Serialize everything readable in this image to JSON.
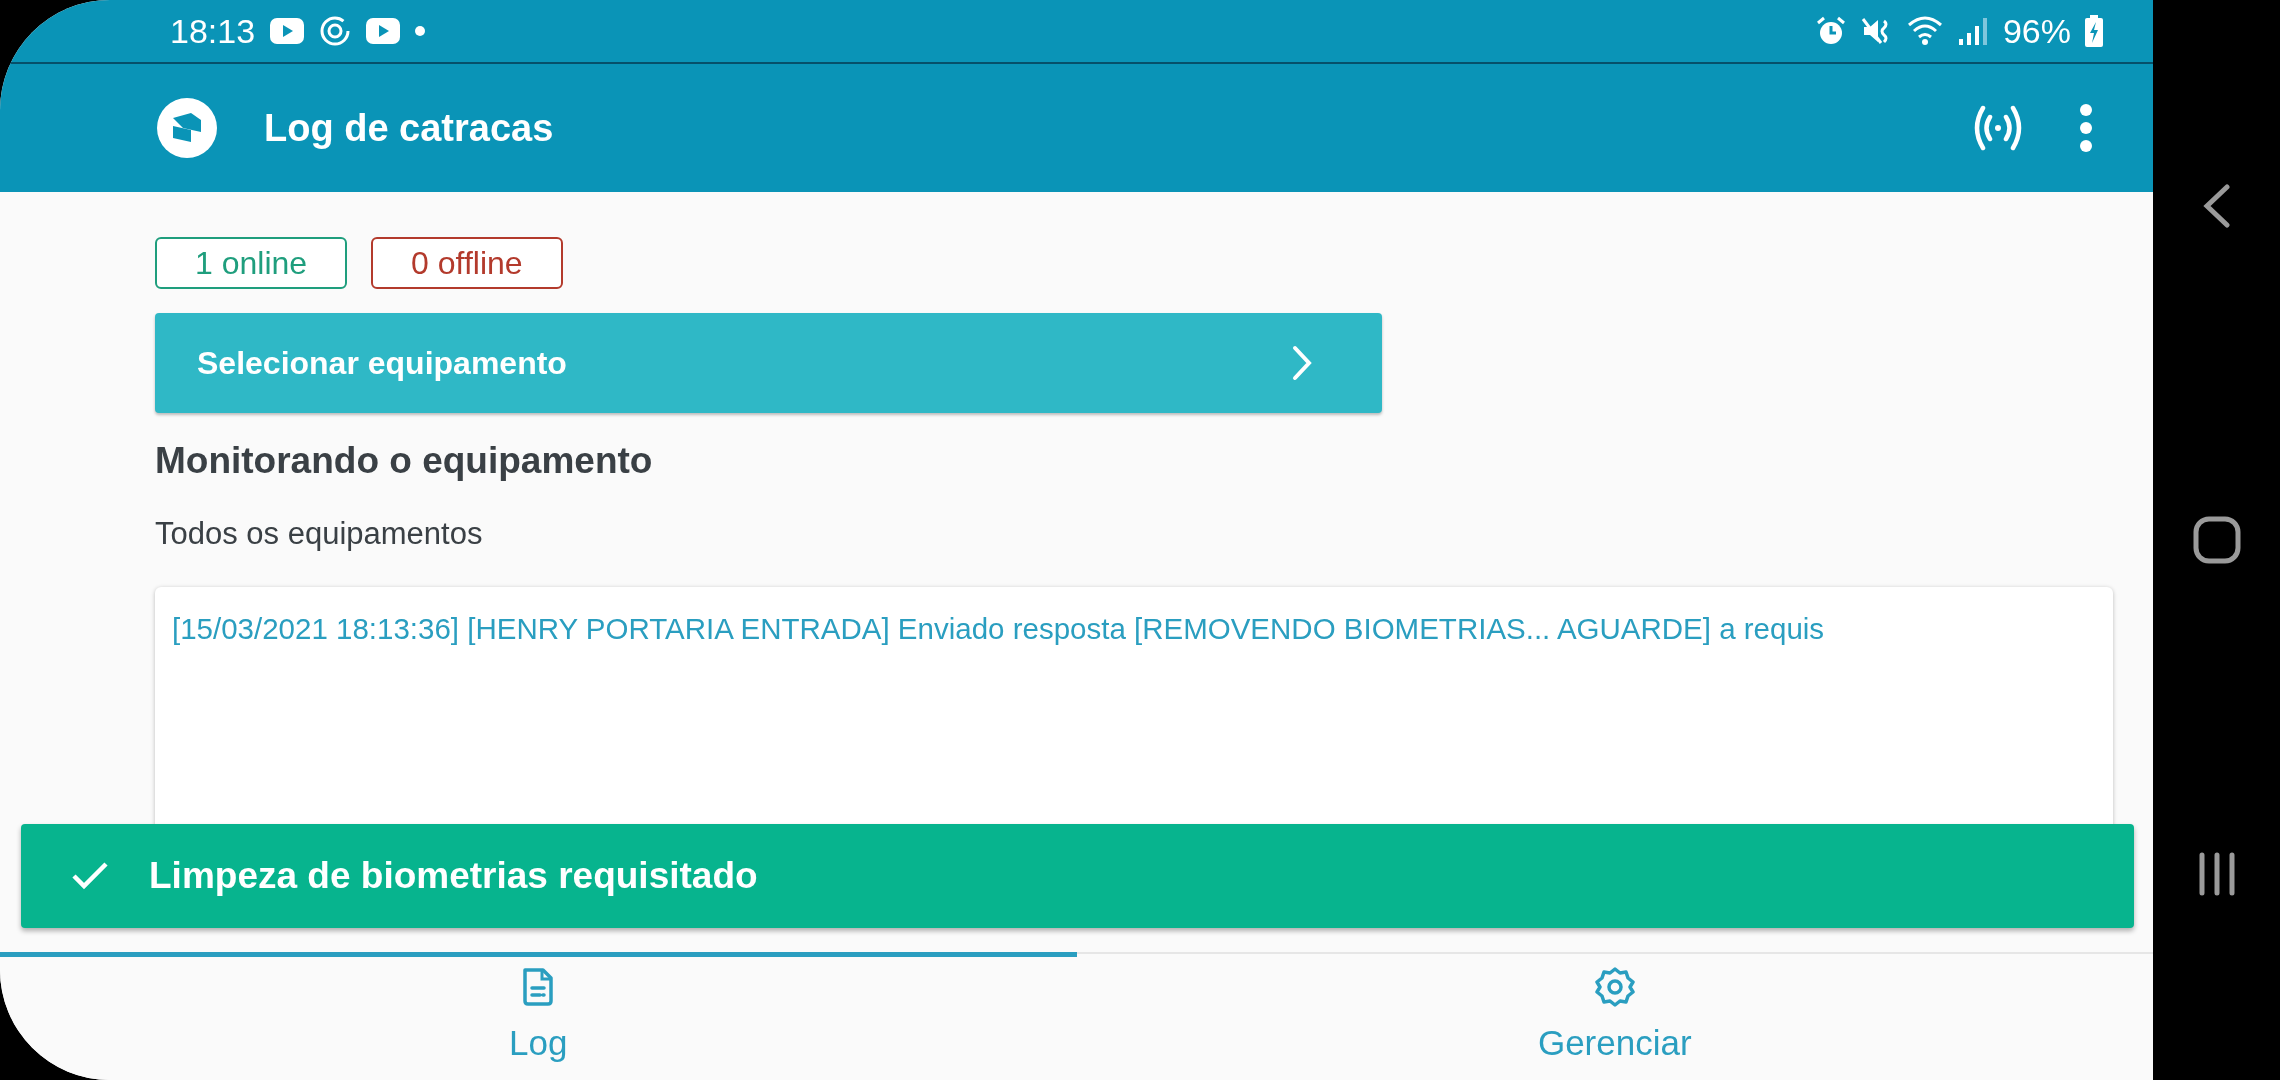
{
  "status_bar": {
    "time": "18:13",
    "battery": "96%"
  },
  "app_bar": {
    "title": "Log de catracas"
  },
  "badges": [
    {
      "label": "1 online",
      "color": "#1f9e7d"
    },
    {
      "label": "0 offline",
      "color": "#b33a2c"
    }
  ],
  "select_button": {
    "label": "Selecionar equipamento"
  },
  "monitor": {
    "heading": "Monitorando o equipamento",
    "subtitle": "Todos os equipamentos"
  },
  "log_lines": [
    "[15/03/2021 18:13:36] [HENRY PORTARIA ENTRADA] Enviado resposta [REMOVENDO BIOMETRIAS... AGUARDE] a requis"
  ],
  "snackbar": {
    "text": "Limpeza de biometrias requisitado"
  },
  "bottom_nav": [
    {
      "label": "Log",
      "kind": "log",
      "selected": true
    },
    {
      "label": "Gerenciar",
      "kind": "settings",
      "selected": false
    }
  ]
}
